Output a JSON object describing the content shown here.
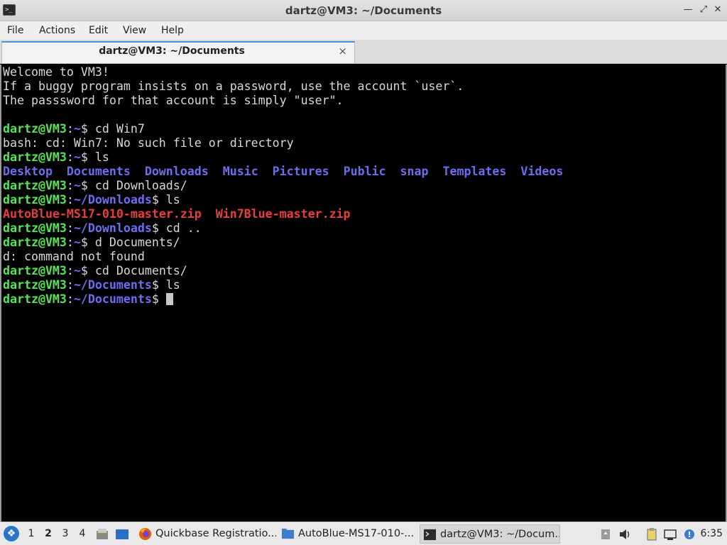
{
  "window": {
    "title": "dartz@VM3: ~/Documents",
    "icon": "terminal-icon"
  },
  "menu": [
    "File",
    "Actions",
    "Edit",
    "View",
    "Help"
  ],
  "tab": {
    "label": "dartz@VM3: ~/Documents",
    "close": "×"
  },
  "terminal": {
    "lines": [
      [
        {
          "t": "Welcome to VM3!",
          "c": "plain"
        }
      ],
      [
        {
          "t": "If a buggy program insists on a password, use the account `user`.",
          "c": "plain"
        }
      ],
      [
        {
          "t": "The passsword for that account is simply \"user\".",
          "c": "plain"
        }
      ],
      [],
      [
        {
          "t": "dartz@VM3",
          "c": "user"
        },
        {
          "t": ":",
          "c": "plain"
        },
        {
          "t": "~",
          "c": "path"
        },
        {
          "t": "$ cd Win7",
          "c": "plain"
        }
      ],
      [
        {
          "t": "bash: cd: Win7: No such file or directory",
          "c": "plain"
        }
      ],
      [
        {
          "t": "dartz@VM3",
          "c": "user"
        },
        {
          "t": ":",
          "c": "plain"
        },
        {
          "t": "~",
          "c": "path"
        },
        {
          "t": "$ ls",
          "c": "plain"
        }
      ],
      [
        {
          "t": "Desktop",
          "c": "dir"
        },
        {
          "t": "  ",
          "c": "plain"
        },
        {
          "t": "Documents",
          "c": "dir"
        },
        {
          "t": "  ",
          "c": "plain"
        },
        {
          "t": "Downloads",
          "c": "dir"
        },
        {
          "t": "  ",
          "c": "plain"
        },
        {
          "t": "Music",
          "c": "dir"
        },
        {
          "t": "  ",
          "c": "plain"
        },
        {
          "t": "Pictures",
          "c": "dir"
        },
        {
          "t": "  ",
          "c": "plain"
        },
        {
          "t": "Public",
          "c": "dir"
        },
        {
          "t": "  ",
          "c": "plain"
        },
        {
          "t": "snap",
          "c": "dir"
        },
        {
          "t": "  ",
          "c": "plain"
        },
        {
          "t": "Templates",
          "c": "dir"
        },
        {
          "t": "  ",
          "c": "plain"
        },
        {
          "t": "Videos",
          "c": "dir"
        }
      ],
      [
        {
          "t": "dartz@VM3",
          "c": "user"
        },
        {
          "t": ":",
          "c": "plain"
        },
        {
          "t": "~",
          "c": "path"
        },
        {
          "t": "$ cd Downloads/",
          "c": "plain"
        }
      ],
      [
        {
          "t": "dartz@VM3",
          "c": "user"
        },
        {
          "t": ":",
          "c": "plain"
        },
        {
          "t": "~/Downloads",
          "c": "path"
        },
        {
          "t": "$ ls",
          "c": "plain"
        }
      ],
      [
        {
          "t": "AutoBlue-MS17-010-master.zip",
          "c": "zip"
        },
        {
          "t": "  ",
          "c": "plain"
        },
        {
          "t": "Win7Blue-master.zip",
          "c": "zip"
        }
      ],
      [
        {
          "t": "dartz@VM3",
          "c": "user"
        },
        {
          "t": ":",
          "c": "plain"
        },
        {
          "t": "~/Downloads",
          "c": "path"
        },
        {
          "t": "$ cd ..",
          "c": "plain"
        }
      ],
      [
        {
          "t": "dartz@VM3",
          "c": "user"
        },
        {
          "t": ":",
          "c": "plain"
        },
        {
          "t": "~",
          "c": "path"
        },
        {
          "t": "$ d Documents/",
          "c": "plain"
        }
      ],
      [
        {
          "t": "d: command not found",
          "c": "plain"
        }
      ],
      [
        {
          "t": "dartz@VM3",
          "c": "user"
        },
        {
          "t": ":",
          "c": "plain"
        },
        {
          "t": "~",
          "c": "path"
        },
        {
          "t": "$ cd Documents/",
          "c": "plain"
        }
      ],
      [
        {
          "t": "dartz@VM3",
          "c": "user"
        },
        {
          "t": ":",
          "c": "plain"
        },
        {
          "t": "~/Documents",
          "c": "path"
        },
        {
          "t": "$ ls",
          "c": "plain"
        }
      ],
      [
        {
          "t": "dartz@VM3",
          "c": "user"
        },
        {
          "t": ":",
          "c": "plain"
        },
        {
          "t": "~/Documents",
          "c": "path"
        },
        {
          "t": "$ ",
          "c": "plain"
        }
      ]
    ]
  },
  "taskbar": {
    "workspaces": [
      "1",
      "2",
      "3",
      "4"
    ],
    "active_workspace": "2",
    "tasks": [
      {
        "label": "Quickbase Registratio...",
        "icon": "firefox-icon"
      },
      {
        "label": "AutoBlue-MS17-010-...",
        "icon": "folder-icon"
      },
      {
        "label": "dartz@VM3: ~/Docum...",
        "icon": "terminal-icon"
      }
    ],
    "clock": "6:35"
  },
  "colors": {
    "user": "#54e654",
    "path": "#6d6df0",
    "zip": "#ec3d3d",
    "text": "#d8d8d8",
    "background": "#000000"
  }
}
